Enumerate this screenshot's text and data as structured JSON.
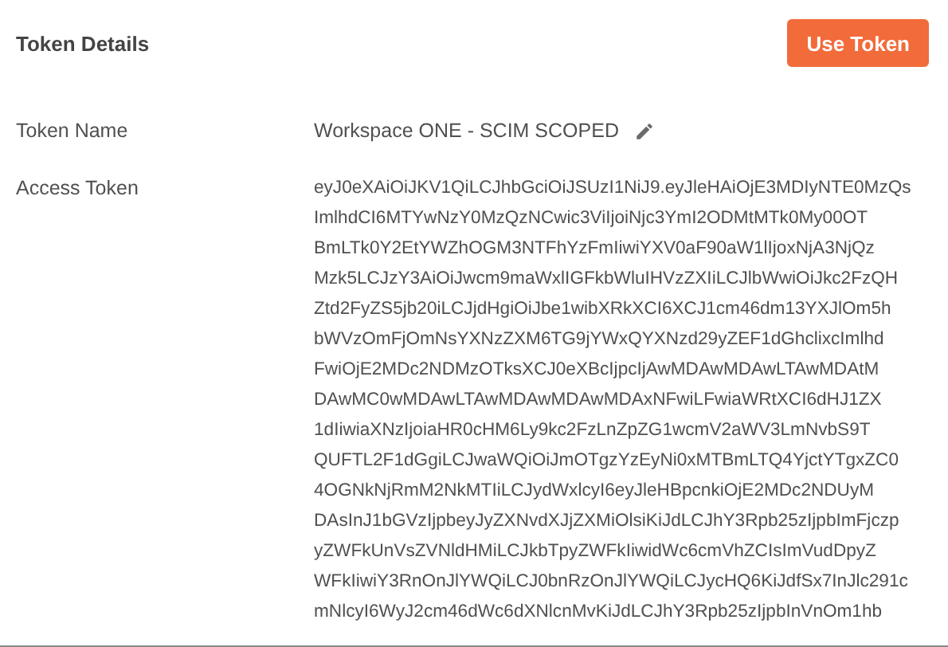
{
  "header": {
    "title": "Token Details",
    "button": "Use Token"
  },
  "token_name": {
    "label": "Token Name",
    "value": "Workspace ONE - SCIM SCOPED"
  },
  "access_token": {
    "label": "Access Token",
    "lines": [
      "eyJ0eXAiOiJKV1QiLCJhbGciOiJSUzI1NiJ9.eyJleHAiOjE3MDIyNTE0MzQs",
      "ImlhdCI6MTYwNzY0MzQzNCwic3ViIjoiNjc3YmI2ODMtMTk0My00OT",
      "BmLTk0Y2EtYWZhOGM3NTFhYzFmIiwiYXV0aF90aW1lIjoxNjA3NjQz",
      "Mzk5LCJzY3AiOiJwcm9maWxlIGFkbWluIHVzZXIiLCJlbWwiOiJkc2FzQH",
      "Ztd2FyZS5jb20iLCJjdHgiOiJbe1wibXRkXCI6XCJ1cm46dm13YXJlOm5h",
      "bWVzOmFjOmNsYXNzZXM6TG9jYWxQYXNzd29yZEF1dGhclixcImlhd",
      "FwiOjE2MDc2NDMzOTksXCJ0eXBcIjpcIjAwMDAwMDAwLTAwMDAtM",
      "DAwMC0wMDAwLTAwMDAwMDAwMDAxNFwiLFwiaWRtXCI6dHJ1ZX",
      "1dIiwiaXNzIjoiaHR0cHM6Ly9kc2FzLnZpZG1wcmV2aWV3LmNvbS9T",
      "QUFTL2F1dGgiLCJwaWQiOiJmOTgzYzEyNi0xMTBmLTQ4YjctYTgxZC0",
      "4OGNkNjRmM2NkMTIiLCJydWxlcyI6eyJleHBpcnkiOjE2MDc2NDUyM",
      "DAsInJ1bGVzIjpbeyJyZXNvdXJjZXMiOlsiKiJdLCJhY3Rpb25zIjpbImFjczp",
      "yZWFkUnVsZVNldHMiLCJkbTpyZWFkIiwidWc6cmVhZCIsImVudDpyZ",
      "WFkIiwiY3RnOnJlYWQiLCJ0bnRzOnJlYWQiLCJycHQ6KiJdfSx7InJlc291c",
      "mNlcyI6WyJ2cm46dWc6dXNlcnMvKiJdLCJhY3Rpb25zIjpbInVnOm1hb"
    ]
  }
}
